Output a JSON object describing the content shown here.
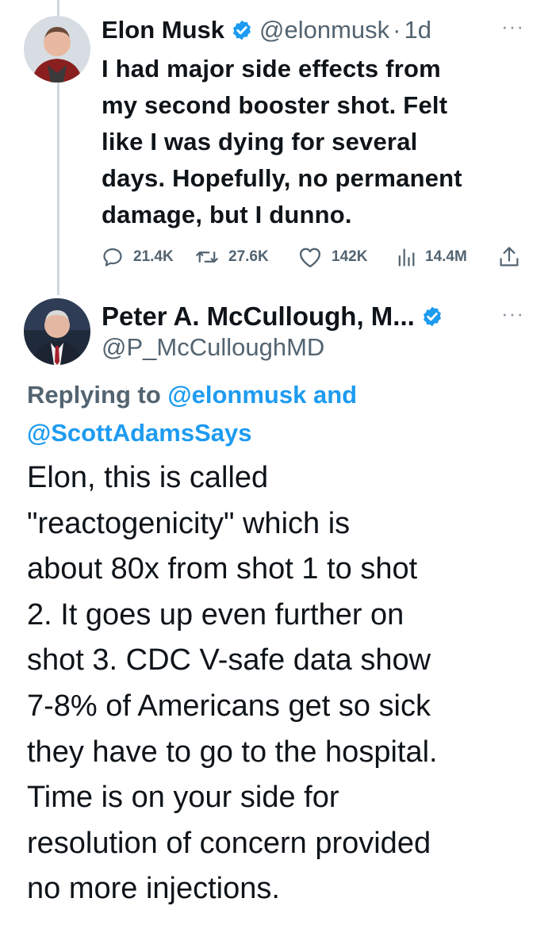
{
  "tweet1": {
    "author_name": "Elon Musk",
    "handle": "@elonmusk",
    "separator": "·",
    "time": "1d",
    "more": "···",
    "text_lines": [
      "I had major side effects from",
      "my second booster shot. Felt",
      "like I was dying for several",
      "days. Hopefully, no permanent",
      "damage, but I dunno."
    ],
    "actions": {
      "replies": "21.4K",
      "retweets": "27.6K",
      "likes": "142K",
      "views": "14.4M"
    }
  },
  "tweet2": {
    "author_name": "Peter A. McCullough, M...",
    "handle": "@P_McCulloughMD",
    "more": "···",
    "replying_prefix": "Replying to",
    "replying_user1": "@elonmusk",
    "replying_and": "and",
    "replying_user2": "@ScottAdamsSays",
    "text_lines": [
      "Elon, this is called",
      "\"reactogenicity\" which is",
      "about 80x from shot 1 to shot",
      "2.  It goes up even further on",
      "shot 3.  CDC V-safe data show",
      "7-8% of Americans get so sick",
      "they have to go to the hospital.",
      "Time is on your side for",
      "resolution of concern provided",
      "no more injections."
    ]
  },
  "colors": {
    "text": "#0f1419",
    "secondary": "#536471",
    "link": "#1d9bf0",
    "verified": "#1d9bf0",
    "thread_line": "#cfd9de"
  },
  "icons": {
    "verified": "verified-badge-icon",
    "reply": "reply-icon",
    "retweet": "retweet-icon",
    "like": "heart-icon",
    "views": "views-bar-chart-icon",
    "share": "share-icon",
    "more": "more-dots-icon"
  }
}
